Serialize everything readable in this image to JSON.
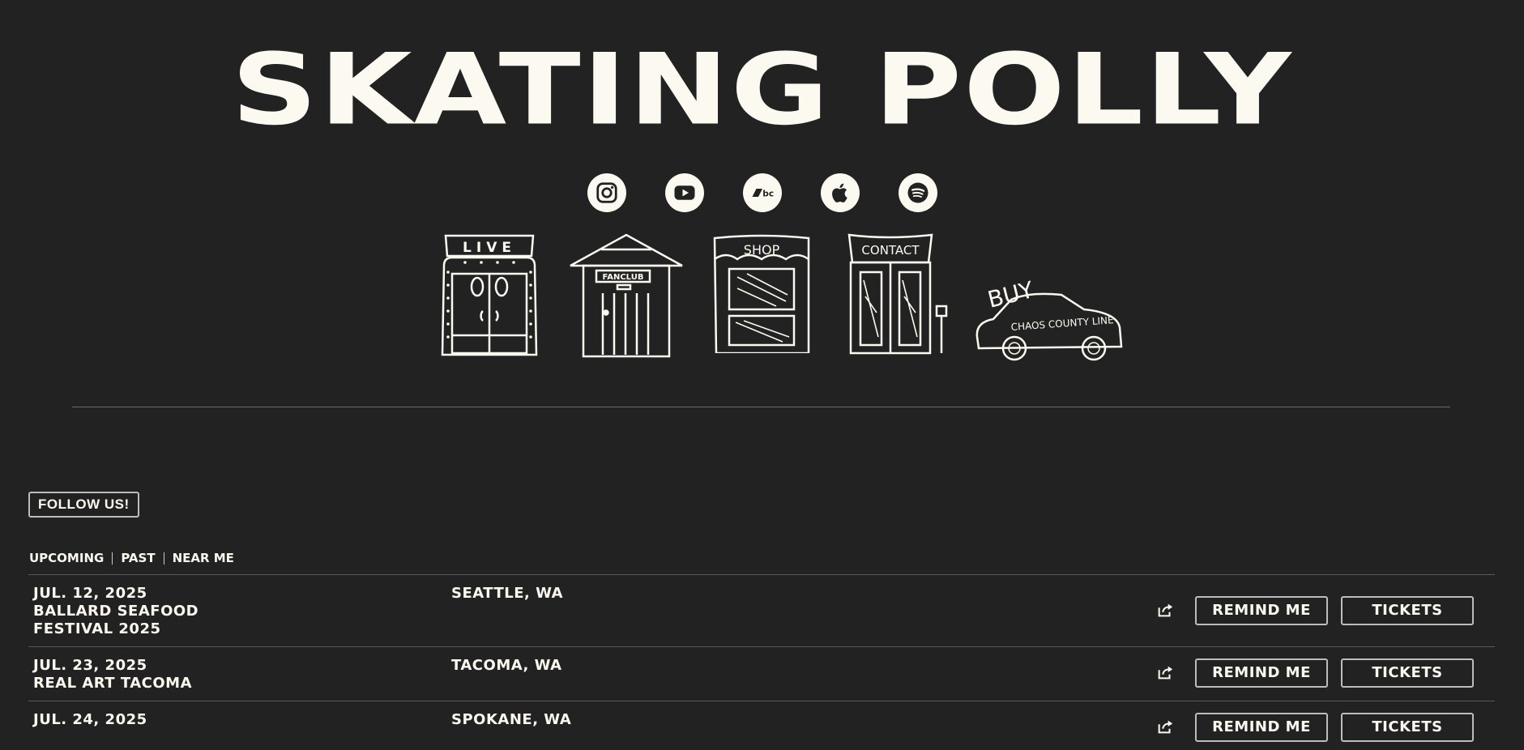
{
  "site": {
    "title": "SKATING POLLY"
  },
  "socials": [
    {
      "icon": "instagram-icon"
    },
    {
      "icon": "youtube-icon"
    },
    {
      "icon": "bandcamp-icon"
    },
    {
      "icon": "apple-music-icon"
    },
    {
      "icon": "spotify-icon"
    }
  ],
  "nav": {
    "live": "LIVE",
    "fanclub": "FANCLUB",
    "shop": "SHOP",
    "contact": "CONTACT",
    "buy": "BUY",
    "album": "CHAOS COUNTY LINE"
  },
  "follow_label": "FOLLOW US!",
  "filters": {
    "upcoming": "UPCOMING",
    "past": "PAST",
    "near_me": "NEAR ME"
  },
  "buttons": {
    "remind": "REMIND ME",
    "tickets": "TICKETS"
  },
  "events": [
    {
      "date": "JUL. 12, 2025",
      "name_line1": "BALLARD SEAFOOD",
      "name_line2": "FESTIVAL 2025",
      "city": "SEATTLE, WA"
    },
    {
      "date": "JUL. 23, 2025",
      "name_line1": "REAL ART TACOMA",
      "name_line2": "",
      "city": "TACOMA, WA"
    },
    {
      "date": "JUL. 24, 2025",
      "name_line1": "",
      "name_line2": "",
      "city": "SPOKANE, WA"
    }
  ]
}
